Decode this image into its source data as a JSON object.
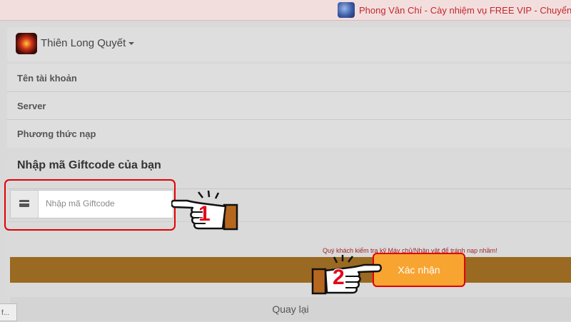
{
  "banner": {
    "text": "Phong Vân Chí - Cày nhiệm vụ FREE VIP - Chuyển p",
    "icon": "game-emblem-icon"
  },
  "game_selector": {
    "name": "Thiên Long Quyết",
    "icon": "game-logo-icon"
  },
  "info_rows": [
    {
      "label": "Tên tài khoản"
    },
    {
      "label": "Server"
    },
    {
      "label": "Phương thức nạp"
    }
  ],
  "giftcode": {
    "title": "Nhập mã Giftcode của bạn",
    "placeholder": "Nhập mã Giftcode",
    "value": "",
    "notice": "Quý khách kiểm tra kỹ Máy chủ/Nhân vật để tránh nạp nhầm!",
    "confirm_label": "Xác nhận",
    "back_label": "Quay lại"
  },
  "annotations": {
    "step1": "1",
    "step2": "2",
    "highlight_color": "#e30000"
  },
  "status_bar": {
    "text": "f..."
  },
  "colors": {
    "banner_text": "#c0282d",
    "confirm_bar": "#9a6a22",
    "confirm_button": "#f7a431",
    "step_number": "#e3061a"
  }
}
